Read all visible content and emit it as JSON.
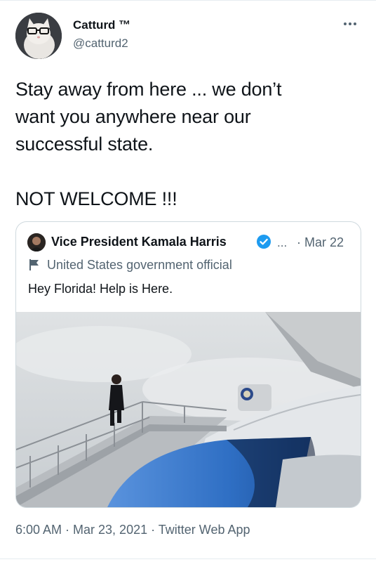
{
  "tweet": {
    "author_name": "Catturd ™",
    "author_handle": "@catturd2",
    "text": "Stay away from here ... we don’t\nwant you anywhere near our\nsuccessful state.\n\nNOT WELCOME !!!",
    "timestamp": "6:00 AM · Mar 23, 2021 · Twitter Web App"
  },
  "quoted_tweet": {
    "author_name": "Vice President Kamala Harris",
    "author_handle": "...",
    "date": "· Mar 22",
    "label": "United States government official",
    "text": "Hey Florida! Help is Here."
  },
  "icons": {
    "more": "more-icon",
    "verified": "verified-badge-icon",
    "flag": "flag-icon"
  },
  "colors": {
    "text": "#0f1419",
    "secondary": "#536471",
    "verified": "#1d9bf0",
    "border": "#cfd9de"
  }
}
